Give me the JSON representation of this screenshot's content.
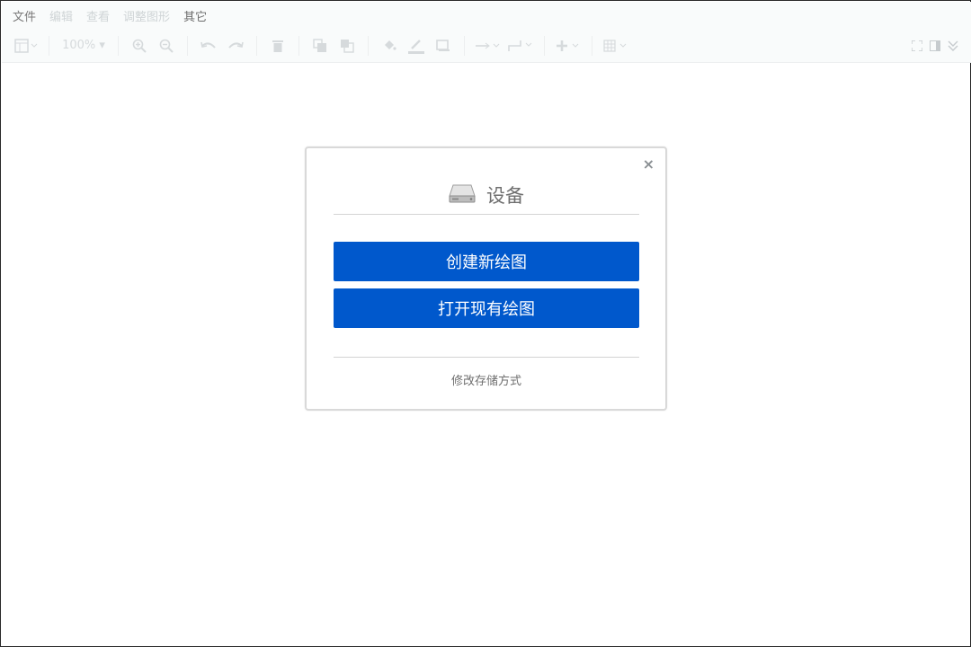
{
  "menubar": {
    "items": [
      {
        "label": "文件"
      },
      {
        "label": "编辑"
      },
      {
        "label": "查看"
      },
      {
        "label": "调整图形"
      },
      {
        "label": "其它"
      }
    ]
  },
  "toolbar": {
    "zoom": "100%",
    "icons": [
      "page-view-icon",
      "zoom-in-icon",
      "zoom-out-icon",
      "undo-icon",
      "redo-icon",
      "delete-icon",
      "to-front-icon",
      "to-back-icon",
      "fill-color-icon",
      "line-color-icon",
      "shadow-icon",
      "connection-icon",
      "waypoints-icon",
      "insert-icon",
      "table-icon",
      "fullscreen-icon",
      "format-panel-icon",
      "collapse-icon"
    ]
  },
  "dialog": {
    "title": "设备",
    "close_label": "×",
    "create_button": "创建新绘图",
    "open_button": "打开现有绘图",
    "change_storage": "修改存储方式"
  },
  "colors": {
    "primary": "#0058cc",
    "title_text": "#6e6e6e"
  }
}
